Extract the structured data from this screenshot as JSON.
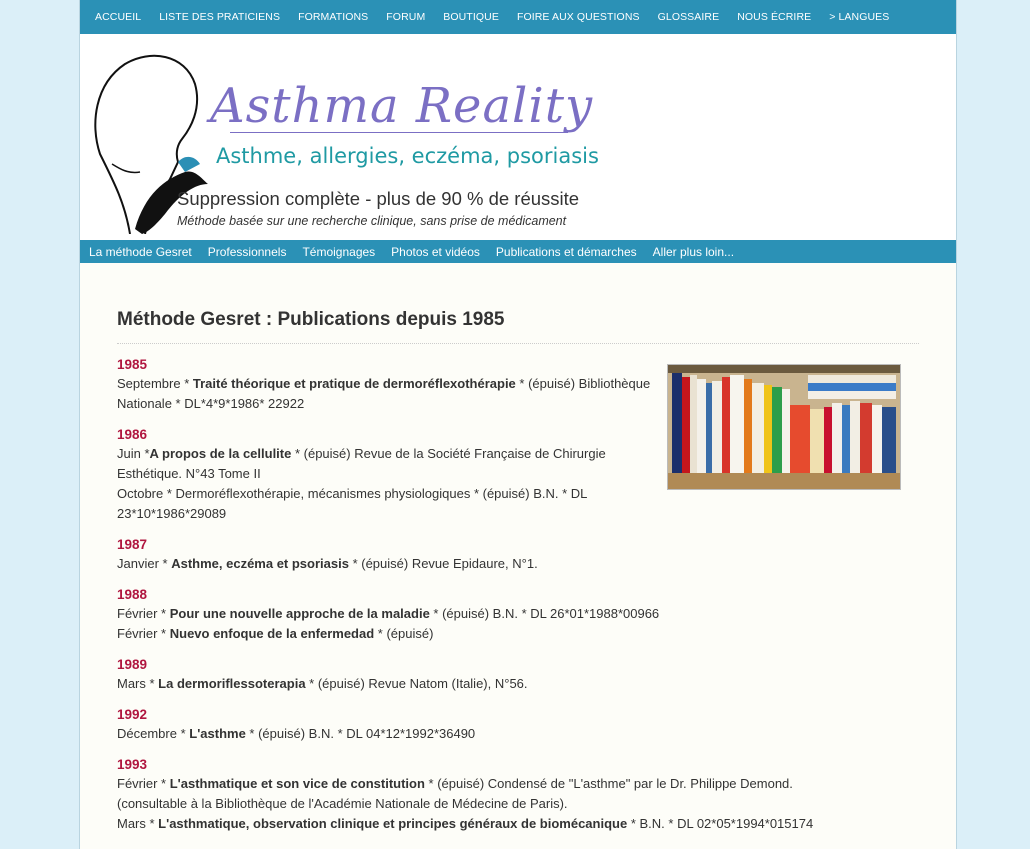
{
  "topnav": [
    "ACCUEIL",
    "LISTE DES PRATICIENS",
    "FORMATIONS",
    "FORUM",
    "BOUTIQUE",
    "FOIRE AUX QUESTIONS",
    "GLOSSAIRE",
    "NOUS ÉCRIRE",
    "> LANGUES"
  ],
  "header": {
    "title": "Asthma Reality",
    "subtitle": "Asthme, allergies, eczéma, psoriasis",
    "claim": "Suppression complète - plus de 90 % de réussite",
    "method": "Méthode basée sur une recherche clinique, sans prise de médicament"
  },
  "subnav": [
    "La méthode Gesret",
    "Professionnels",
    "Témoignages",
    "Photos et vidéos",
    "Publications et démarches",
    "Aller plus loin..."
  ],
  "page_title": "Méthode Gesret : Publications depuis 1985",
  "entries": [
    {
      "year": "1985",
      "lines": [
        {
          "pre": "Septembre * ",
          "bold": "Traité théorique et pratique de dermoréflexothérapie",
          "post": " * (épuisé) Bibliothèque Nationale * DL*4*9*1986* 22922"
        }
      ]
    },
    {
      "year": "1986",
      "lines": [
        {
          "pre": "Juin *",
          "bold": "A propos de la cellulite",
          "post": " * (épuisé) Revue de la Société Française de Chirurgie Esthétique. N°43 Tome II"
        },
        {
          "pre": "Octobre * Dermoréflexothérapie, mécanismes physiologiques * (épuisé) B.N. * DL 23*10*1986*29089",
          "bold": "",
          "post": ""
        }
      ]
    },
    {
      "year": "1987",
      "lines": [
        {
          "pre": "Janvier * ",
          "bold": "Asthme, eczéma et psoriasis",
          "post": " * (épuisé) Revue Epidaure, N°1."
        }
      ]
    },
    {
      "year": "1988",
      "lines": [
        {
          "pre": "Février * ",
          "bold": "Pour une nouvelle approche de la maladie",
          "post": " * (épuisé) B.N. * DL 26*01*1988*00966"
        },
        {
          "pre": "Février * ",
          "bold": "Nuevo enfoque de la enfermedad",
          "post": " * (épuisé)"
        }
      ]
    },
    {
      "year": "1989",
      "lines": [
        {
          "pre": "Mars * ",
          "bold": "La dermoriflessoterapia",
          "post": " * (épuisé) Revue Natom (Italie), N°56."
        }
      ]
    },
    {
      "year": "1992",
      "lines": [
        {
          "pre": "Décembre * ",
          "bold": "L'asthme",
          "post": " * (épuisé) B.N. * DL 04*12*1992*36490"
        }
      ]
    },
    {
      "year": "1993",
      "lines": [
        {
          "pre": "Février * ",
          "bold": "L'asthmatique et son vice de constitution",
          "post": " * (épuisé) Condensé de \"L'asthme\" par le Dr. Philippe Demond. (consultable à la Bibliothèque de l'Académie Nationale de Médecine de Paris)."
        },
        {
          "pre": "Mars * ",
          "bold": "L'asthmatique, observation clinique et principes généraux de biomécanique",
          "post": " * B.N. * DL 02*05*1994*015174"
        }
      ]
    }
  ]
}
